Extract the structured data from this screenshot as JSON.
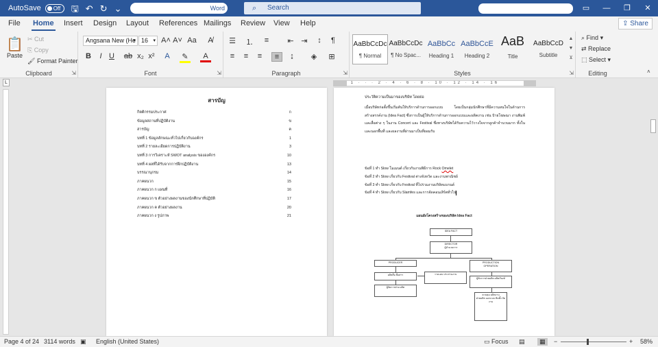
{
  "titlebar": {
    "autosave_label": "AutoSave",
    "autosave_state": "Off",
    "doc_name_suffix": "Word",
    "search_placeholder": "Search",
    "accent": "#2b579a"
  },
  "tabs": [
    "File",
    "Home",
    "Insert",
    "Design",
    "Layout",
    "References",
    "Mailings",
    "Review",
    "View",
    "Help"
  ],
  "active_tab": "Home",
  "share_label": "Share",
  "ribbon": {
    "clipboard": {
      "label": "Clipboard",
      "paste": "Paste",
      "cut": "Cut",
      "copy": "Copy",
      "format_painter": "Format Painter"
    },
    "font": {
      "label": "Font",
      "font_name": "Angsana New (He",
      "font_size": "16"
    },
    "paragraph": {
      "label": "Paragraph"
    },
    "styles": {
      "label": "Styles",
      "items": [
        {
          "sample": "AaBbCcDc",
          "name": "¶ Normal"
        },
        {
          "sample": "AaBbCcDc",
          "name": "¶ No Spac..."
        },
        {
          "sample": "AaBbCc",
          "name": "Heading 1"
        },
        {
          "sample": "AaBbCcE",
          "name": "Heading 2"
        },
        {
          "sample": "AaB",
          "name": "Title"
        },
        {
          "sample": "AaBbCcD",
          "name": "Subtitle"
        }
      ]
    },
    "editing": {
      "label": "Editing",
      "find": "Find",
      "replace": "Replace",
      "select": "Select"
    }
  },
  "ruler_text": "2 · 1 · · · 2 · 4 · 6 · 8 · 10 · 12 · 14 · 16",
  "left_page": {
    "title": "สารบัญ",
    "toc": [
      {
        "text": "กิตติกรรมประกาศ",
        "page": "ก"
      },
      {
        "text": "ข้อมูลสถานที่ปฏิบัติงาน",
        "page": "ข"
      },
      {
        "text": "สารบัญ",
        "page": "ค"
      },
      {
        "text": "บทที่ 1 ข้อมูลลักษณะทั่วไปเกี่ยวกับองค์กร",
        "page": "1"
      },
      {
        "text": "บทที่ 2 รายละเอียดการปฏิบัติงาน",
        "page": "3"
      },
      {
        "text": "บทที่ 3 การวิเคราะห์ SWOT analysis ขององค์กร",
        "page": "10"
      },
      {
        "text": "บทที่ 4 ผลที่ได้รับจากการฝึกปฏิบัติงาน",
        "page": "13"
      },
      {
        "text": "บรรณานุกรม",
        "page": "14"
      },
      {
        "text": "ภาคผนวก",
        "page": "15"
      },
      {
        "text": "ภาคผนวก ก แผนที่",
        "page": "16"
      },
      {
        "text": "ภาคผนวก ข ตัวอย่างผลงานของนักศึกษาที่ปฏิบัติ",
        "page": "17"
      },
      {
        "text": "ภาคผนวก ค ตัวอย่างผลงาน",
        "page": "20"
      },
      {
        "text": "ภาคผนวก ง รูปภาพ",
        "page": "21"
      }
    ]
  },
  "right_page": {
    "heading": "ประวัติความเป็นมาของบริษัท โดยย่อ",
    "paragraph": "เมื่อบริษัทก่อตั้งขึ้นเริ่มต้นให้บริการด้านการออกแบบ โดยเป็นกลุ่มนักศึกษาที่มีความสนใจในด้านการสร้างสรรค์งาน (Idea Fact) ซึ่งการเป็นผู้ให้บริการด้านการออกแบบและผลิตงาน เช่น ป้ายโฆษณา งานพิมพ์ และสื่อต่าง ๆ ในงาน Concert และ Festival ซึ่งทางบริษัทได้รับความไว้วางใจจากลูกค้าจำนวนมาก ทั้งในและนอกพื้นที่ และผลงานที่ผ่านมาเป็นที่ยอมรับ",
    "list": [
      "ข้อที่ 1 ทำ Slow โมเมนต์ เกี่ยวกับงานพิธีการ Rock",
      "ข้อที่ 2 ทำ Slow เกี่ยวกับ Festival ต่างจังหวัด และงานพาณิชย์",
      "ข้อที่ 3 ทำ Slow เกี่ยวกับ Festival ที่ไปร่วมงานบริษัทแบรนด์",
      "ข้อที่ 4 ทำ Slow เกี่ยวกับ Slamfes และการจัดคอนเสิร์ตทั่วไป"
    ],
    "squiggle_word": "Omelet",
    "chart_title": "แผนผังโครงสร้างของบริษัท Idea Fact",
    "org": {
      "top": "IDEA FACT",
      "director": [
        "DIRECTOR",
        "ผู้อำนวยการ"
      ],
      "producer": "PRODUCER",
      "production": [
        "PRODUCTION",
        "OPERATION"
      ],
      "p1": "ผลิตสื่อ สื่อสาร",
      "p2": "วางแผน ประสานงาน",
      "p3": "ผู้จัดการฝ่าย ผลิต",
      "p4": "ควบคุม ผลิตงาน",
      "p5": "ฝ่ายผลิต ออกแบบ ติดตั้ง จัดงาน",
      "p6": "ผู้จัดการฝ่ายผลิต ผลิตภัณฑ์"
    }
  },
  "statusbar": {
    "page": "Page 4 of 24",
    "words": "3114 words",
    "language": "English (United States)",
    "focus": "Focus",
    "zoom": "58%"
  }
}
